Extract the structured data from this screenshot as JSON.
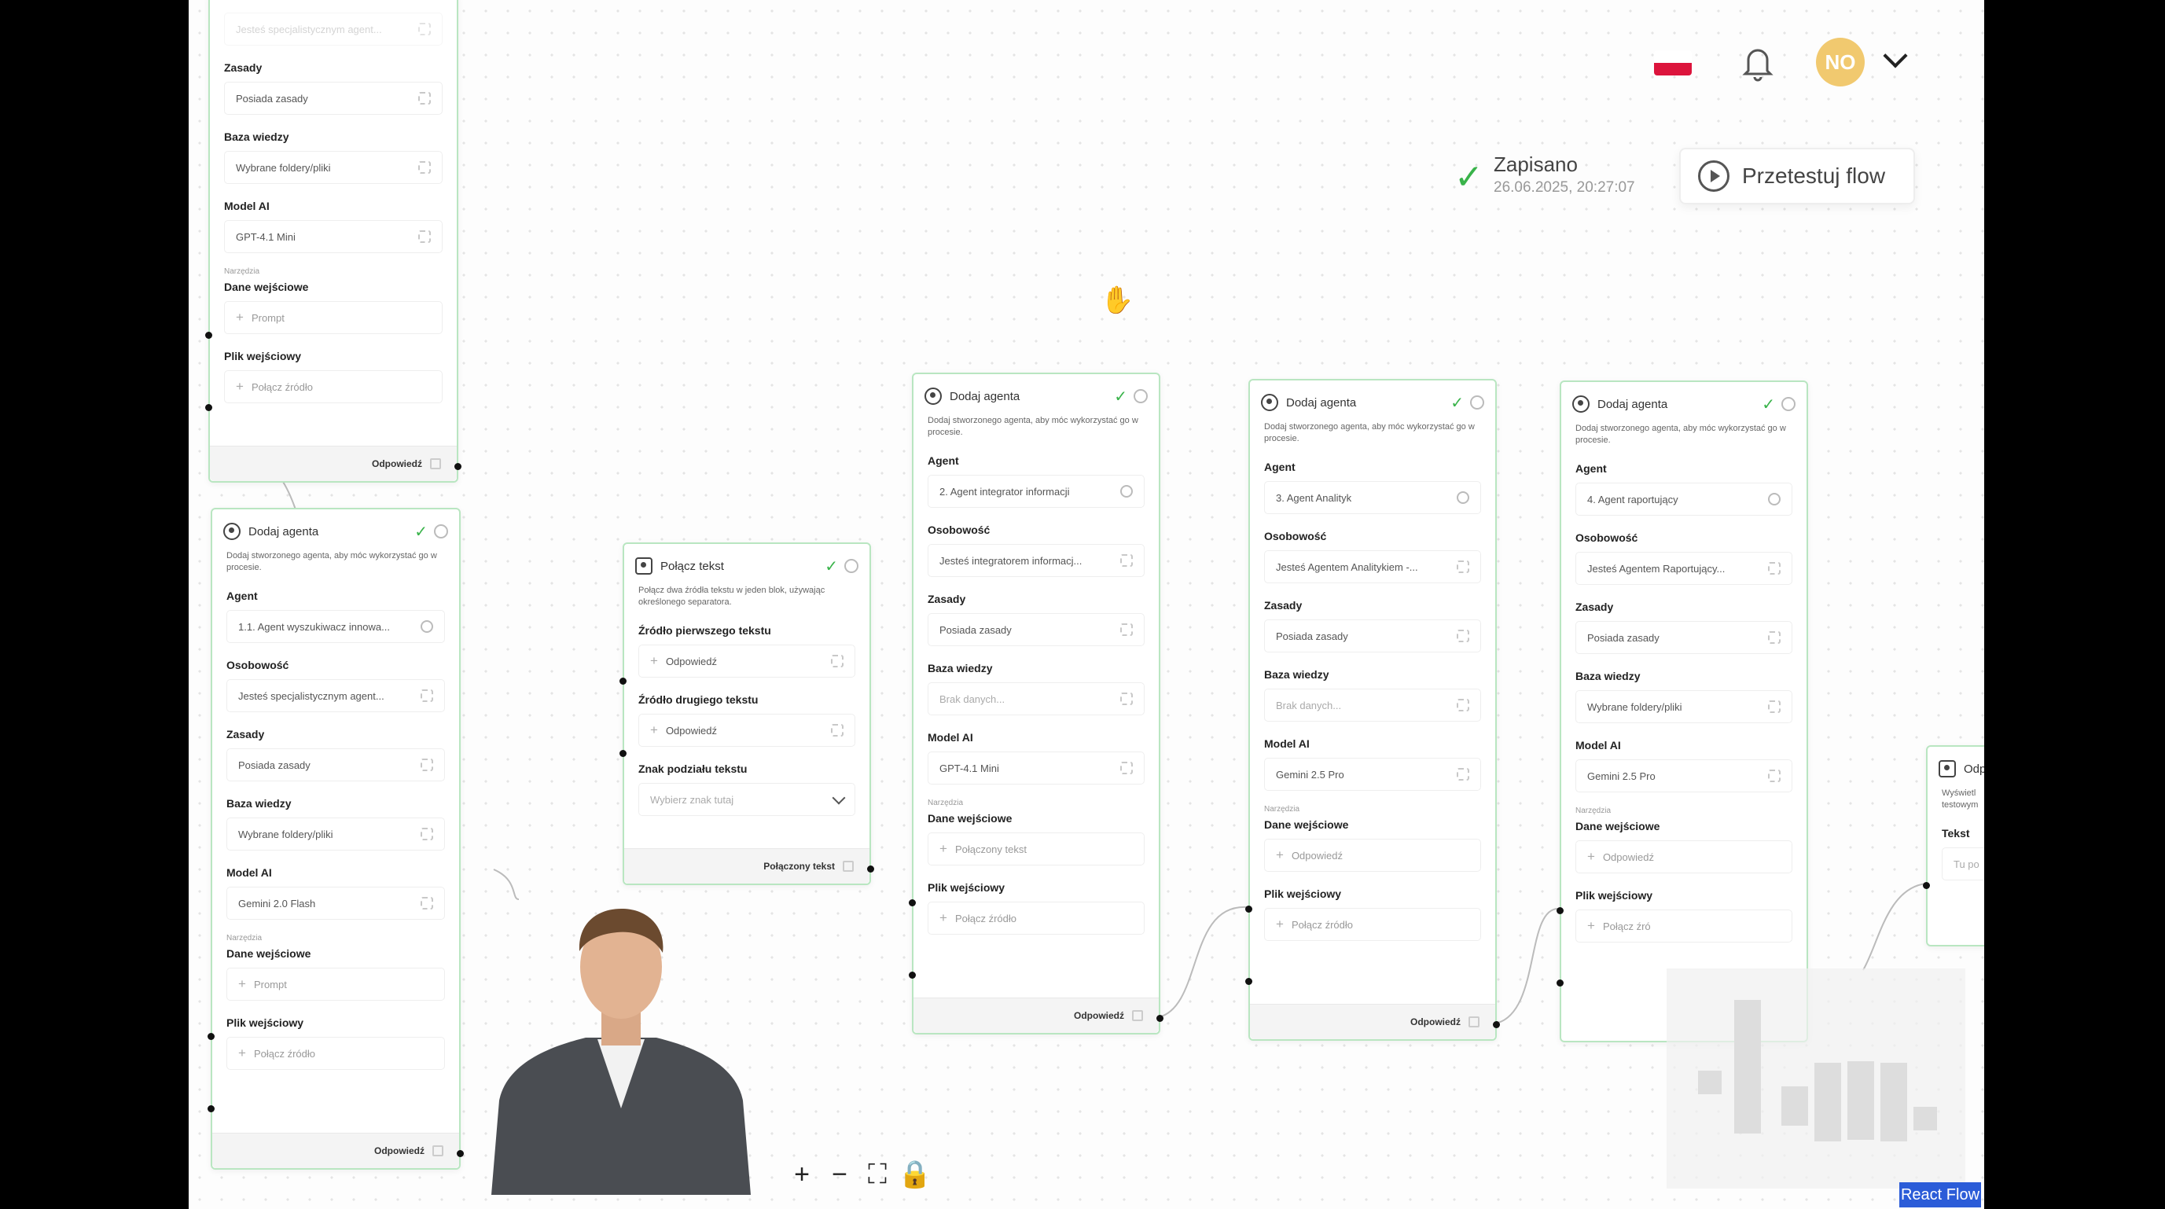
{
  "header": {
    "avatar_initials": "NO",
    "saved_label": "Zapisano",
    "saved_time": "26.06.2025, 20:27:07",
    "test_flow_label": "Przetestuj flow"
  },
  "colors": {
    "node_border": "#b9e6c1",
    "check": "#39b34a",
    "avatar": "#f1c96f",
    "react_flow_badge": "#2b5cd8"
  },
  "nodes": {
    "top_left": {
      "faded_field": "Jesteś specjalistycznym agent...",
      "label_rules": "Zasady",
      "rules_value": "Posiada zasady",
      "label_kb": "Baza wiedzy",
      "kb_value": "Wybrane foldery/pliki",
      "label_model": "Model AI",
      "model_value": "GPT-4.1 Mini",
      "label_tools": "Narzędzia",
      "label_input": "Dane wejściowe",
      "input_value": "Prompt",
      "label_file": "Plik wejściowy",
      "file_value": "Połącz źródło",
      "footer": "Odpowiedź"
    },
    "left": {
      "title": "Dodaj agenta",
      "desc": "Dodaj stworzonego agenta, aby móc wykorzystać go w procesie.",
      "label_agent": "Agent",
      "agent_value": "1.1. Agent wyszukiwacz innowa...",
      "label_persona": "Osobowość",
      "persona_value": "Jesteś specjalistycznym agent...",
      "label_rules": "Zasady",
      "rules_value": "Posiada zasady",
      "label_kb": "Baza wiedzy",
      "kb_value": "Wybrane foldery/pliki",
      "label_model": "Model AI",
      "model_value": "Gemini 2.0 Flash",
      "label_tools": "Narzędzia",
      "label_input": "Dane wejściowe",
      "input_value": "Prompt",
      "label_file": "Plik wejściowy",
      "file_value": "Połącz źródło",
      "footer": "Odpowiedź"
    },
    "join": {
      "title": "Połącz tekst",
      "desc": "Połącz dwa źródła tekstu w jeden blok, używając określonego separatora.",
      "label_src1": "Źródło pierwszego tekstu",
      "src1_value": "Odpowiedź",
      "label_src2": "Źródło drugiego tekstu",
      "src2_value": "Odpowiedź",
      "label_sep": "Znak podziału tekstu",
      "sep_placeholder": "Wybierz znak tutaj",
      "footer": "Połączony tekst"
    },
    "agent2": {
      "title": "Dodaj agenta",
      "desc": "Dodaj stworzonego agenta, aby móc wykorzystać go w procesie.",
      "label_agent": "Agent",
      "agent_value": "2. Agent integrator informacji",
      "label_persona": "Osobowość",
      "persona_value": "Jesteś integratorem informacj...",
      "label_rules": "Zasady",
      "rules_value": "Posiada zasady",
      "label_kb": "Baza wiedzy",
      "kb_value": "Brak danych...",
      "label_model": "Model AI",
      "model_value": "GPT-4.1 Mini",
      "label_tools": "Narzędzia",
      "label_input": "Dane wejściowe",
      "input_value": "Połączony tekst",
      "label_file": "Plik wejściowy",
      "file_value": "Połącz źródło",
      "footer": "Odpowiedź"
    },
    "agent3": {
      "title": "Dodaj agenta",
      "desc": "Dodaj stworzonego agenta, aby móc wykorzystać go w procesie.",
      "label_agent": "Agent",
      "agent_value": "3. Agent Analityk",
      "label_persona": "Osobowość",
      "persona_value": "Jesteś Agentem Analitykiem -...",
      "label_rules": "Zasady",
      "rules_value": "Posiada zasady",
      "label_kb": "Baza wiedzy",
      "kb_value": "Brak danych...",
      "label_model": "Model AI",
      "model_value": "Gemini 2.5 Pro",
      "label_tools": "Narzędzia",
      "label_input": "Dane wejściowe",
      "input_value": "Odpowiedź",
      "label_file": "Plik wejściowy",
      "file_value": "Połącz źródło",
      "footer": "Odpowiedź"
    },
    "agent4": {
      "title": "Dodaj agenta",
      "desc": "Dodaj stworzonego agenta, aby móc wykorzystać go w procesie.",
      "label_agent": "Agent",
      "agent_value": "4. Agent raportujący",
      "label_persona": "Osobowość",
      "persona_value": "Jesteś Agentem Raportujący...",
      "label_rules": "Zasady",
      "rules_value": "Posiada zasady",
      "label_kb": "Baza wiedzy",
      "kb_value": "Wybrane foldery/pliki",
      "label_model": "Model AI",
      "model_value": "Gemini 2.5 Pro",
      "label_tools": "Narzędzia",
      "label_input": "Dane wejściowe",
      "input_value": "Odpowiedź",
      "label_file": "Plik wejściowy",
      "file_value": "Połącz źró"
    },
    "partial": {
      "title": "Odp",
      "desc": "Wyświetl testowym",
      "label_text": "Tekst",
      "text_value": "Tu po"
    }
  },
  "canvas_controls": {
    "react_flow_label": "React Flow"
  }
}
